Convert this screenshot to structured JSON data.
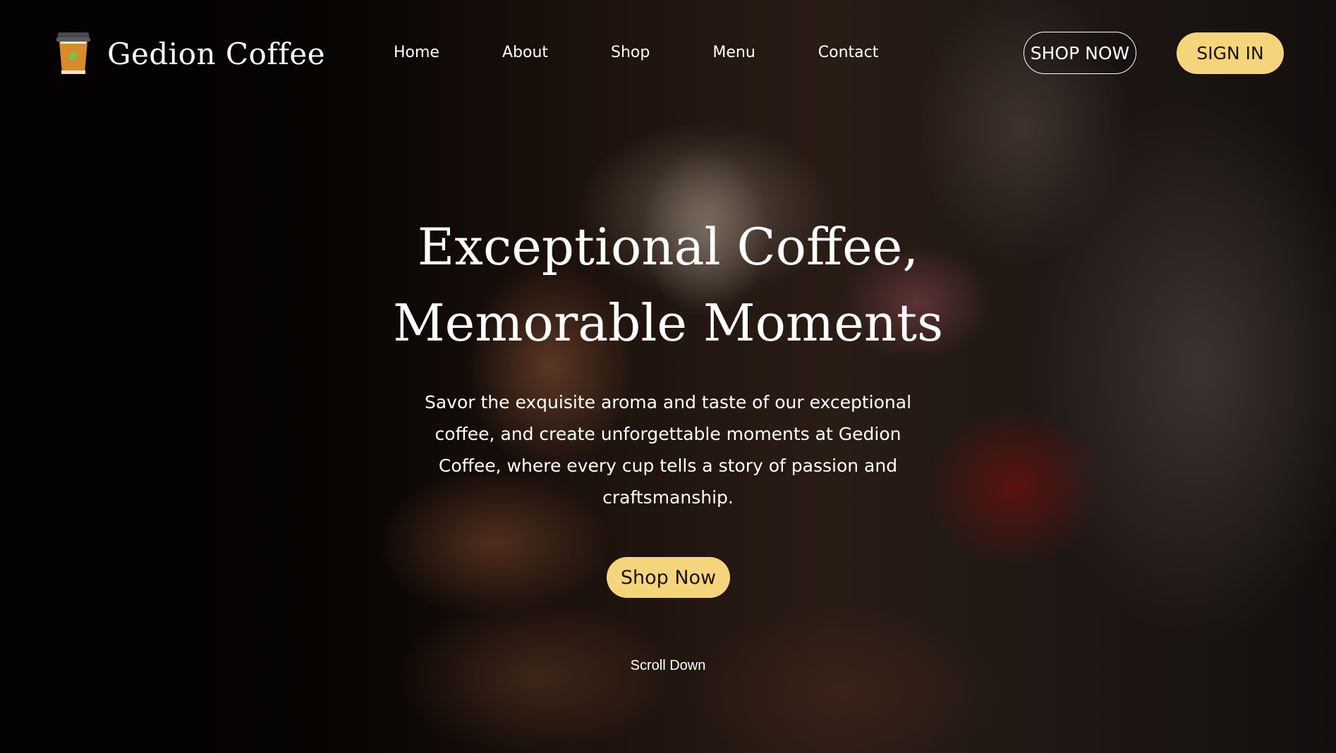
{
  "header": {
    "brand": "Gedion Coffee",
    "logo_icon": "coffee-cup-icon",
    "nav": [
      {
        "label": "Home"
      },
      {
        "label": "About"
      },
      {
        "label": "Shop"
      },
      {
        "label": "Menu"
      },
      {
        "label": "Contact"
      }
    ],
    "shop_now_label": "SHOP NOW",
    "sign_in_label": "SIGN IN"
  },
  "hero": {
    "headline_line1": "Exceptional Coffee,",
    "headline_line2": "Memorable Moments",
    "description": "Savor the exquisite aroma and taste of our exceptional coffee, and create unforgettable moments at Gedion Coffee, where every cup tells a story of passion and craftsmanship.",
    "cta_label": "Shop Now",
    "scroll_label": "Scroll Down"
  },
  "colors": {
    "accent_yellow": "#f5d57c",
    "text": "#ffffff",
    "cup_orange": "#d98a2b",
    "cup_lid": "#4a4a4a",
    "bean_green": "#7cc04b"
  }
}
